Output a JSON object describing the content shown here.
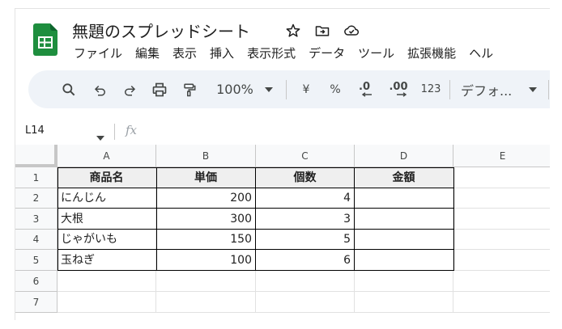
{
  "document": {
    "title": "無題のスプレッドシート",
    "icons": [
      "star-icon",
      "move-to-folder-icon",
      "cloud-saved-icon"
    ]
  },
  "menu": [
    "ファイル",
    "編集",
    "表示",
    "挿入",
    "表示形式",
    "データ",
    "ツール",
    "拡張機能",
    "ヘル"
  ],
  "toolbar": {
    "zoom": "100%",
    "currency": "¥",
    "percent": "%",
    "decrease_decimal": ".0",
    "increase_decimal": ".00",
    "number_format": "123",
    "font": "デフォ..."
  },
  "formula_bar": {
    "name_box": "L14",
    "fx": "fx",
    "formula": ""
  },
  "sheet": {
    "columns": [
      "A",
      "B",
      "C",
      "D",
      "E"
    ],
    "rows": [
      "1",
      "2",
      "3",
      "4",
      "5",
      "6",
      "7"
    ],
    "cells": [
      [
        "商品名",
        "単価",
        "個数",
        "金額",
        ""
      ],
      [
        "にんじん",
        "200",
        "4",
        "",
        ""
      ],
      [
        "大根",
        "300",
        "3",
        "",
        ""
      ],
      [
        "じゃがいも",
        "150",
        "5",
        "",
        ""
      ],
      [
        "玉ねぎ",
        "100",
        "6",
        "",
        ""
      ],
      [
        "",
        "",
        "",
        "",
        ""
      ],
      [
        "",
        "",
        "",
        "",
        ""
      ]
    ]
  },
  "colors": {
    "sheets_green": "#188038",
    "header_fill": "#efefef",
    "toolbar_bg": "#eff3f8"
  }
}
